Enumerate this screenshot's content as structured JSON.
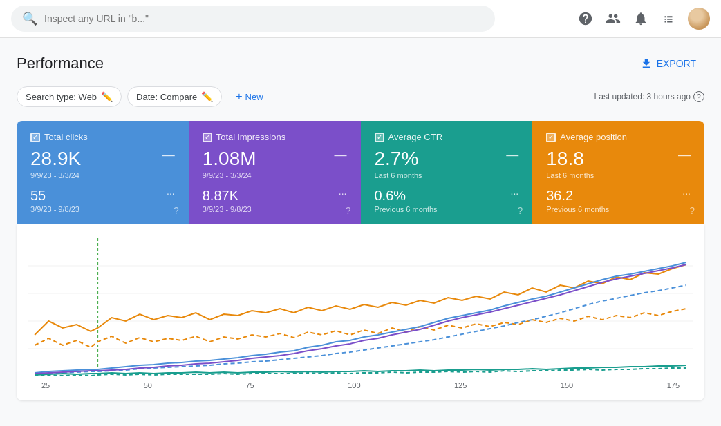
{
  "topbar": {
    "search_placeholder": "Inspect any URL in \"b...\"",
    "help_icon": "?",
    "accounts_icon": "person",
    "notifications_icon": "bell",
    "apps_icon": "grid"
  },
  "header": {
    "title": "Performance",
    "export_label": "EXPORT"
  },
  "filters": {
    "search_type_label": "Search type: Web",
    "date_compare_label": "Date: Compare",
    "new_label": "New",
    "last_updated": "Last updated: 3 hours ago"
  },
  "cards": [
    {
      "id": "total-clicks",
      "label": "Total clicks",
      "color": "blue",
      "main_value": "28.9K",
      "main_period": "9/9/23 - 3/3/24",
      "compare_value": "55",
      "compare_period": "3/9/23 - 9/8/23"
    },
    {
      "id": "total-impressions",
      "label": "Total impressions",
      "color": "purple",
      "main_value": "1.08M",
      "main_period": "9/9/23 - 3/3/24",
      "compare_value": "8.87K",
      "compare_period": "3/9/23 - 9/8/23"
    },
    {
      "id": "average-ctr",
      "label": "Average CTR",
      "color": "teal",
      "main_value": "2.7%",
      "main_period": "Last 6 months",
      "compare_value": "0.6%",
      "compare_period": "Previous 6 months"
    },
    {
      "id": "average-position",
      "label": "Average position",
      "color": "orange",
      "main_value": "18.8",
      "main_period": "Last 6 months",
      "compare_value": "36.2",
      "compare_period": "Previous 6 months"
    }
  ],
  "chart": {
    "x_labels": [
      "25",
      "50",
      "75",
      "100",
      "125",
      "150",
      "175"
    ]
  }
}
